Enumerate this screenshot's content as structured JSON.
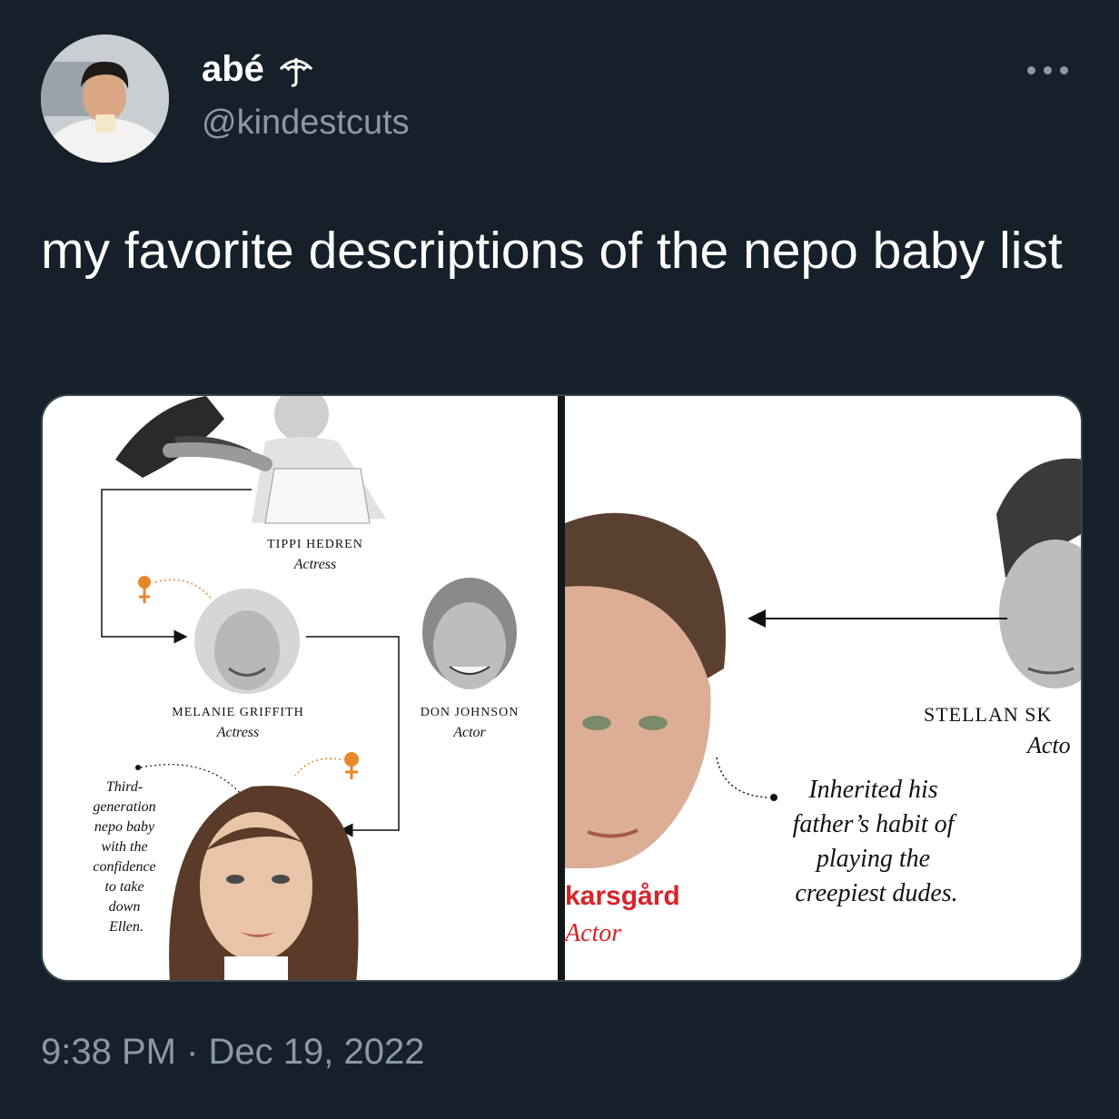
{
  "tweet": {
    "display_name": "abé",
    "name_icon": "umbrella-icon",
    "handle": "@kindestcuts",
    "more_icon": "more-dots-icon",
    "text": "my favorite descriptions of the nepo baby list",
    "time": "9:38 PM",
    "separator": "·",
    "date": "Dec 19, 2022"
  },
  "media": {
    "left_panel": {
      "tippi": {
        "name": "TIPPI HEDREN",
        "role": "Actress"
      },
      "melanie": {
        "name": "MELANIE GRIFFITH",
        "role": "Actress"
      },
      "don": {
        "name": "DON JOHNSON",
        "role": "Actor"
      },
      "caption_lines": [
        "Third-",
        "generation",
        "nepo baby",
        "with the",
        "confidence",
        "to take",
        "down",
        "Ellen."
      ]
    },
    "right_panel": {
      "stellan": {
        "name": "STELLAN SK",
        "role": "Acto"
      },
      "bill": {
        "name": "karsgård",
        "role": "Actor"
      },
      "caption_lines": [
        "Inherited his",
        "father’s habit of",
        "playing the",
        "creepiest dudes."
      ]
    },
    "colors": {
      "accent_orange": "#e8862a",
      "bill_name_red": "#d8232a"
    }
  }
}
